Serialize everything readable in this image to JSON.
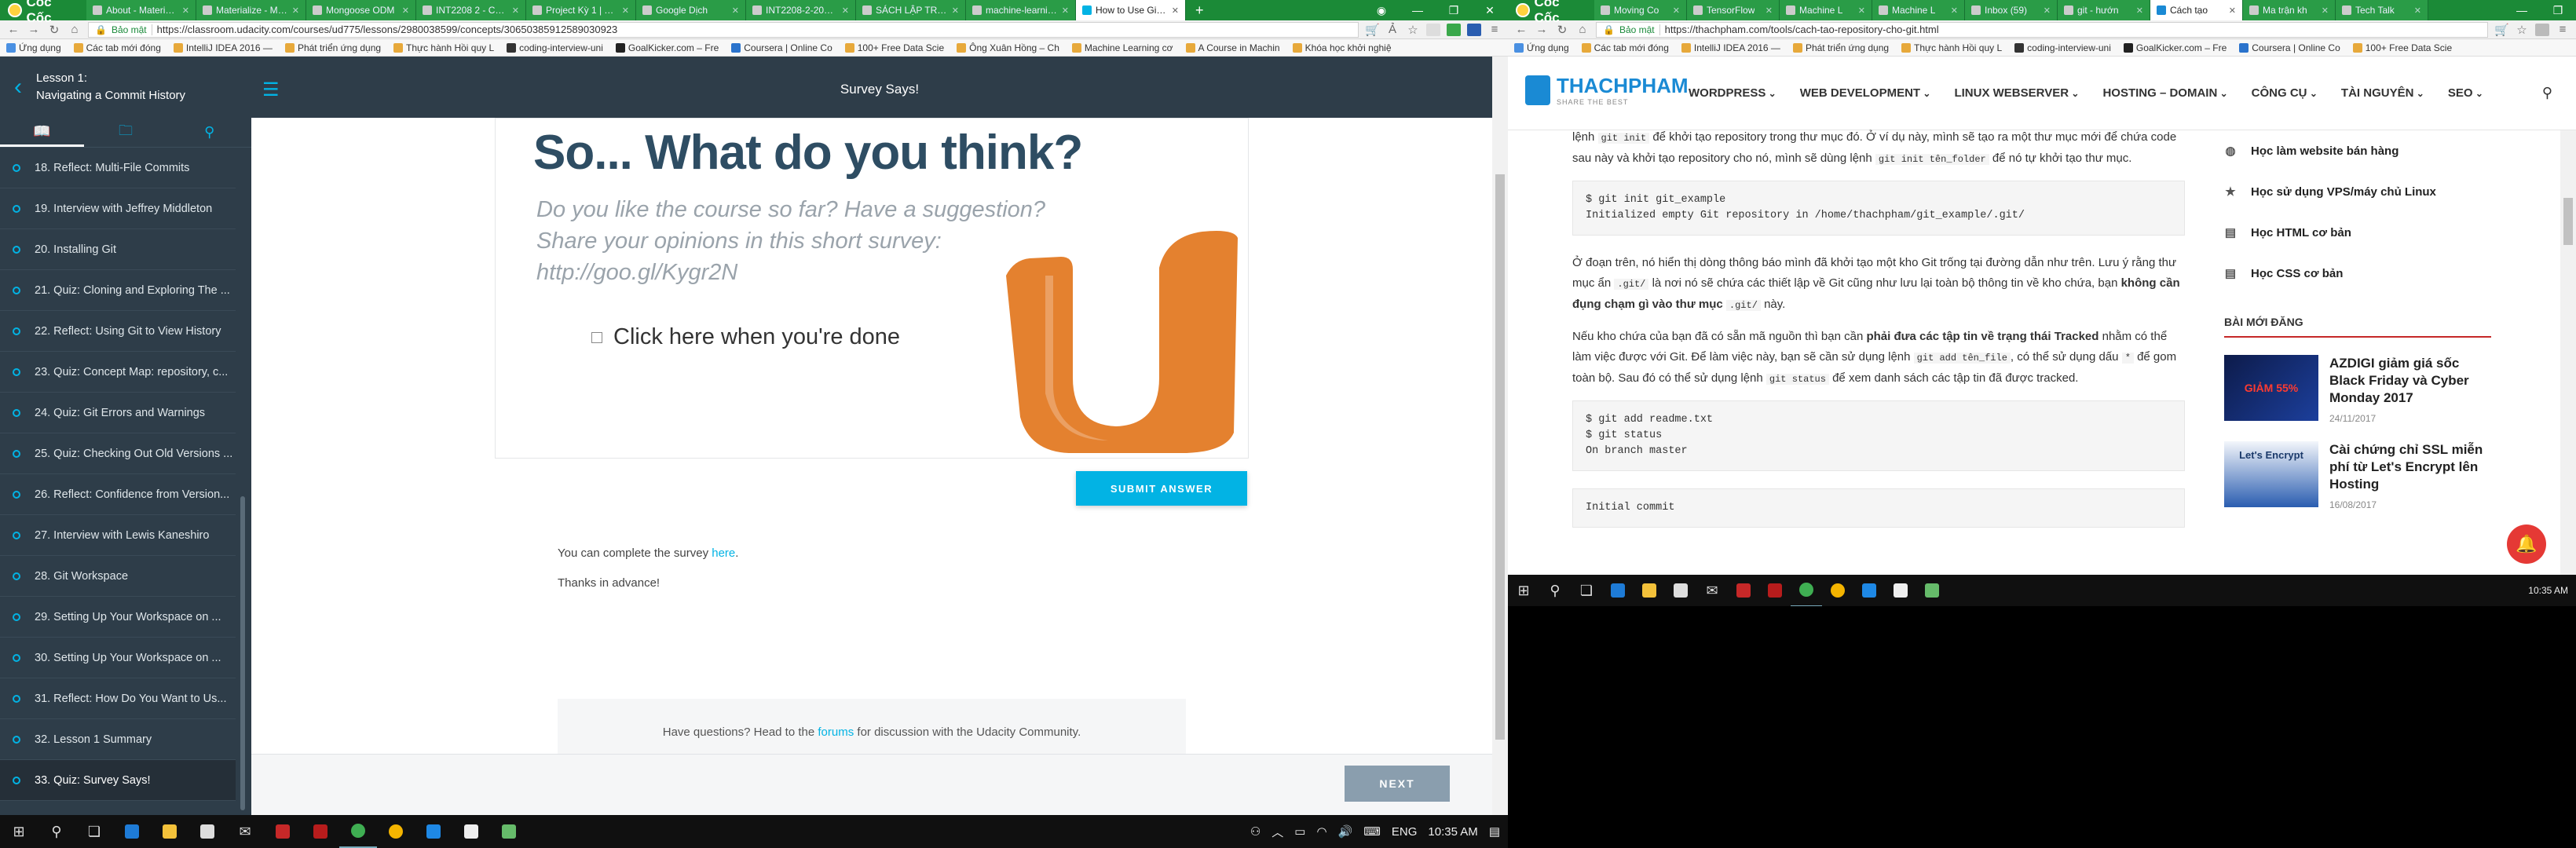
{
  "left": {
    "tabs": [
      {
        "title": "About - Materialize"
      },
      {
        "title": "Materialize - Mate"
      },
      {
        "title": "Mongoose ODM"
      },
      {
        "title": "INT2208 2 - Công"
      },
      {
        "title": "Project Kỳ 1 | Trello"
      },
      {
        "title": "Google Dịch"
      },
      {
        "title": "INT2208-2-2018/S"
      },
      {
        "title": "SÁCH LẬP TRÌNH"
      },
      {
        "title": "machine-learning"
      },
      {
        "title": "How to Use Git an"
      }
    ],
    "browser_logo": "Cốc Cốc",
    "security": "Bảo mật",
    "url": "https://classroom.udacity.com/courses/ud775/lessons/2980038599/concepts/30650385912589030923",
    "bookmarks": [
      "Ứng dụng",
      "Các tab mới đóng",
      "IntelliJ IDEA 2016 —",
      "Phát triển ứng dụng",
      "Thực hành Hồi quy L",
      "coding-interview-uni",
      "GoalKicker.com – Fre",
      "Coursera | Online Co",
      "100+ Free Data Scie",
      "Ông Xuân Hồng – Ch",
      "Machine Learning cơ",
      "A Course in Machin",
      "Khóa học khởi nghiệ"
    ],
    "sidebar": {
      "lesson_number": "Lesson 1:",
      "lesson_title": "Navigating a Commit History",
      "items": [
        "18. Reflect: Multi-File Commits",
        "19. Interview with Jeffrey Middleton",
        "20. Installing Git",
        "21. Quiz: Cloning and Exploring The ...",
        "22. Reflect: Using Git to View History",
        "23. Quiz: Concept Map: repository, c...",
        "24. Quiz: Git Errors and Warnings",
        "25. Quiz: Checking Out Old Versions ...",
        "26. Reflect: Confidence from Version...",
        "27. Interview with Lewis Kaneshiro",
        "28. Git Workspace",
        "29. Setting Up Your Workspace on ...",
        "30. Setting Up Your Workspace on ...",
        "31. Reflect: How Do You Want to Us...",
        "32. Lesson 1 Summary",
        "33. Quiz: Survey Says!"
      ]
    },
    "page_title": "Survey Says!",
    "survey": {
      "heading": "So... What do you think?",
      "subtitle": "Do you like the course so far? Have a suggestion? Share your opinions in this short survey: http://goo.gl/Kygr2N",
      "checkbox_label": "Click here when you're done"
    },
    "submit_label": "SUBMIT ANSWER",
    "complete_text": "You can complete the survey",
    "complete_link": "here",
    "complete_end": ".",
    "thanks": "Thanks in advance!",
    "help_prefix": "Have questions? Head to the",
    "help_link": "forums",
    "help_suffix": "for discussion with the Udacity Community.",
    "next_label": "NEXT",
    "taskbar": {
      "lang": "ENG",
      "time": "10:35 AM"
    }
  },
  "right": {
    "tabs": [
      {
        "title": "Moving Co"
      },
      {
        "title": "TensorFlow"
      },
      {
        "title": "Machine L"
      },
      {
        "title": "Machine L"
      },
      {
        "title": "Inbox (59)"
      },
      {
        "title": "git - hướn"
      },
      {
        "title": "Cách tạo"
      },
      {
        "title": "Ma trận kh"
      },
      {
        "title": "Tech Talk"
      }
    ],
    "browser_logo": "Cốc Cốc",
    "security": "Bảo mật",
    "url": "https://thachpham.com/tools/cach-tao-repository-cho-git.html",
    "bookmarks": [
      "Ứng dụng",
      "Các tab mới đóng",
      "IntelliJ IDEA 2016 —",
      "Phát triển ứng dụng",
      "Thực hành Hồi quy L",
      "coding-interview-uni",
      "GoalKicker.com – Fre",
      "Coursera | Online Co",
      "100+ Free Data Scie"
    ],
    "site_name": "THACHPHAM",
    "site_tagline": "SHARE THE BEST",
    "menu": [
      "WORDPRESS",
      "WEB DEVELOPMENT",
      "LINUX WEBSERVER",
      "HOSTING – DOMAIN",
      "CÔNG CỤ",
      "TÀI NGUYÊN",
      "SEO"
    ],
    "article": {
      "p1_a": "lệnh",
      "p1_code1": "git init",
      "p1_b": "để khởi tạo repository trong thư mục đó. Ở ví dụ này, mình sẽ tạo ra một thư mục mới để chứa code sau này và khởi tạo repository cho nó, mình sẽ dùng lệnh",
      "p1_code2": "git init tên_folder",
      "p1_c": "để nó tự khởi tạo thư mục.",
      "code1": "$ git init git_example\nInitialized empty Git repository in /home/thachpham/git_example/.git/",
      "p2_a": "Ở đoạn trên, nó hiển thị dòng thông báo mình đã khởi tạo một kho Git trống tại đường dẫn như trên. Lưu ý rằng thư mục ẩn",
      "p2_code": ".git/",
      "p2_b": "là nơi nó sẽ chứa các thiết lập về Git cũng như lưu lại toàn bộ thông tin về kho chứa, bạn",
      "p2_strong": "không cần đụng chạm gì vào thư mục",
      "p2_code2": ".git/",
      "p2_c": "này.",
      "p3_a": "Nếu kho chứa của bạn đã có sẵn mã nguồn thì bạn cần",
      "p3_strong": "phải đưa các tập tin về trạng thái Tracked",
      "p3_b": "nhằm có thể làm việc được với Git. Để làm việc này, bạn sẽ cần sử dụng lệnh",
      "p3_code1": "git add tên_file",
      "p3_c": ", có thể sử dụng dấu",
      "p3_code2": "*",
      "p3_d": "để gom toàn bộ. Sau đó có thể sử dụng lệnh",
      "p3_code3": "git status",
      "p3_e": "để xem danh sách các tập tin đã được tracked.",
      "code2": "$ git add readme.txt\n$ git status\nOn branch master",
      "code3": "Initial commit"
    },
    "side_links": [
      "Học làm website bán hàng",
      "Học sử dụng VPS/máy chủ Linux",
      "Học HTML cơ bản",
      "Học CSS cơ bản"
    ],
    "new_posts_title": "BÀI MỚI ĐĂNG",
    "posts": [
      {
        "title": "AZDIGI giảm giá sốc Black Friday và Cyber Monday 2017",
        "date": "24/11/2017",
        "thumb_text": "GIẢM 55%"
      },
      {
        "title": "Cài chứng chỉ SSL miễn phí từ Let's Encrypt lên Hosting",
        "date": "16/08/2017",
        "thumb_text": "Let's Encrypt"
      }
    ],
    "taskbar": {
      "time": "10:35 AM"
    }
  }
}
